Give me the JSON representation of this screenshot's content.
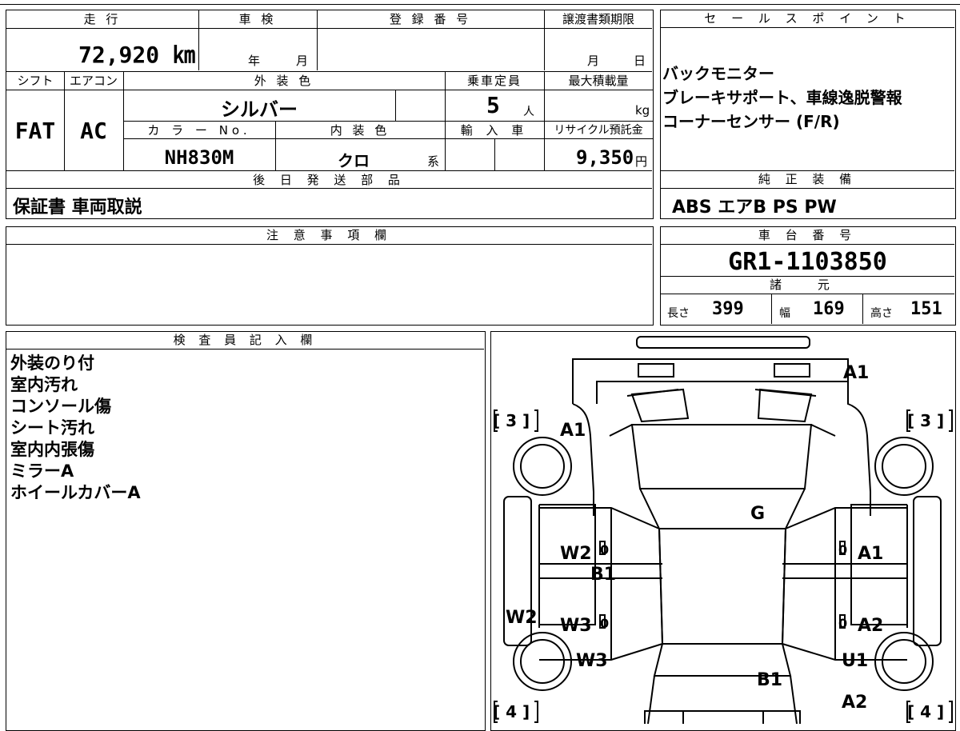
{
  "vehicle": {
    "mileage_label": "走 行",
    "mileage": "72,920 ㎞",
    "inspection_label": "車 検",
    "inspection_year": "年",
    "inspection_month": "月",
    "registration_label": "登 録 番 号",
    "transfer_label": "譲渡書類期限",
    "transfer_month": "月",
    "transfer_day": "日",
    "shift_label": "シフト",
    "shift": "FAT",
    "ac_label": "エアコン",
    "ac": "AC",
    "exterior_color_label": "外 装 色",
    "exterior_color": "シルバー",
    "color_no_label": "カ ラ ー No.",
    "color_no": "NH830M",
    "interior_color_label": "内 装 色",
    "interior_color": "クロ",
    "interior_suffix": "系",
    "capacity_label": "乗車定員",
    "capacity": "5",
    "capacity_unit": "人",
    "max_load_label": "最大積載量",
    "max_load_unit": "kg",
    "import_label": "輸 入 車",
    "recycle_label": "リサイクル預託金",
    "recycle": "9,350",
    "recycle_unit": "円"
  },
  "later_parts": {
    "label": "後 日 発 送 部 品",
    "value": "保証書 車両取説"
  },
  "notes_section": {
    "label": "注 意 事 項 欄"
  },
  "sales_points": {
    "label": "セ ー ル ス ポ イ ン ト",
    "items": [
      "バックモニター",
      "ブレーキサポート、車線逸脱警報",
      "コーナーセンサー (F/R)"
    ]
  },
  "genuine_equipment": {
    "label": "純 正 装 備",
    "value": "ABS エアB PS PW"
  },
  "chassis": {
    "label": "車 台 番 号",
    "value": "GR1-1103850"
  },
  "specs": {
    "label": "諸 元",
    "length_label": "長さ",
    "length": "399",
    "width_label": "幅",
    "width": "169",
    "height_label": "高さ",
    "height": "151"
  },
  "inspector": {
    "label": "検 査 員 記 入 欄",
    "notes": [
      "外装のり付",
      "室内汚れ",
      "コンソール傷",
      "シート汚れ",
      "室内内張傷",
      "ミラーA",
      "ホイールカバーA"
    ]
  },
  "diagram": {
    "marks": {
      "front_a1": "A1",
      "hood_a1": "A1",
      "roof_g": "G",
      "left_w2": "W2",
      "left_b1": "B1",
      "left_w3": "W3",
      "side_w2": "W2",
      "rear_w3": "W3",
      "rear_b1": "B1",
      "right_a1": "A1",
      "right_a2": "A2",
      "right_u1": "U1",
      "rear_a2": "A2",
      "zero": "0"
    },
    "tire_front_left": "[ 3 ]",
    "tire_front_right": "[ 3 ]",
    "tire_rear_left": "[ 4 ]",
    "tire_rear_right": "[ 4 ]"
  }
}
